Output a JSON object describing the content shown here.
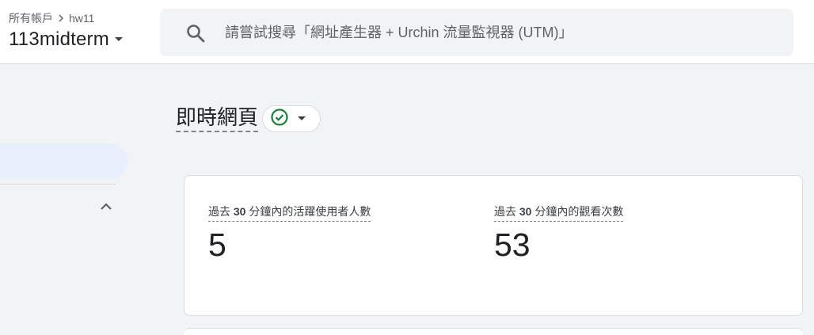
{
  "header": {
    "breadcrumb": {
      "root": "所有帳戶",
      "account": "hw11"
    },
    "property_name": "113midterm",
    "search_placeholder": "請嘗試搜尋「網址產生器 + Urchin 流量監視器 (UTM)」"
  },
  "page": {
    "title": "即時網頁",
    "status": "ok"
  },
  "metrics": [
    {
      "label_prefix": "過去 ",
      "label_number": "30",
      "label_suffix": " 分鐘內的活躍使用者人數",
      "value": "5"
    },
    {
      "label_prefix": "過去 ",
      "label_number": "30",
      "label_suffix": " 分鐘內的觀看次數",
      "value": "53"
    }
  ],
  "colors": {
    "accent_green": "#188038",
    "sidebar_active": "#e8f0fe"
  },
  "icons": [
    "chevron-right-icon",
    "dropdown-caret-icon",
    "search-icon",
    "check-circle-icon",
    "chevron-up-icon"
  ]
}
